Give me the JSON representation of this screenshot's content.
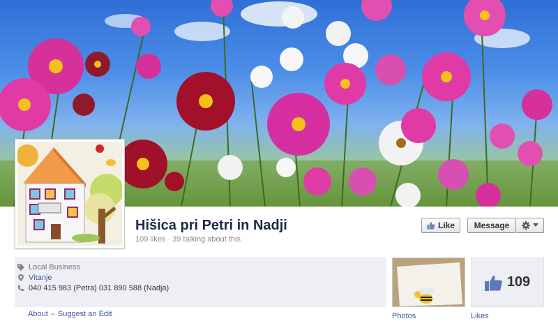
{
  "page": {
    "name": "Hišica pri Petri in Nadji",
    "likes": "109 likes",
    "separator": "·",
    "talking": "39 talking about this"
  },
  "actions": {
    "like_label": "Like",
    "message_label": "Message"
  },
  "info": {
    "category": "Local Business",
    "link": "Vitanje",
    "phone": "040 415 983 (Petra) 031 890 588 (Nadja)"
  },
  "footer": {
    "about": "About",
    "dash": "–",
    "suggest": "Suggest an Edit"
  },
  "tiles": {
    "photos_label": "Photos",
    "likes_count": "109",
    "likes_label": "Likes"
  },
  "icons": {
    "category": "tag-icon",
    "location": "pin-icon",
    "phone": "phone-icon",
    "like": "thumbs-up-icon",
    "gear": "gear-icon"
  },
  "colors": {
    "link": "#3b5998",
    "name": "#1c2a47",
    "info_bg": "#edeff4"
  }
}
